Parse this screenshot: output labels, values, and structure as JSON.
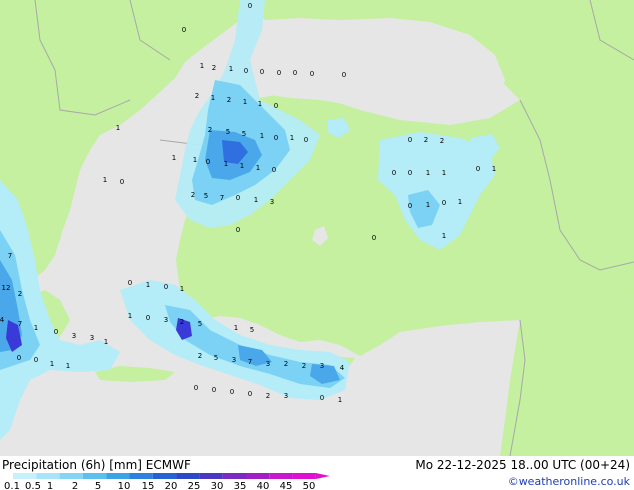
{
  "map": {
    "colors": {
      "sea": "#e6e6e6",
      "land": "#c4f0a0",
      "border": "#a8a8a8",
      "precip_light": "#b4ecf8",
      "precip_mid": "#7cd2f4",
      "precip_heavy": "#4aa8ea",
      "precip_very_heavy": "#2f6fe0",
      "precip_extreme": "#3a3ad8"
    },
    "value_labels": [
      "0",
      "0",
      "1",
      "2",
      "1",
      "0",
      "0",
      "0",
      "0",
      "0",
      "0",
      "2",
      "1",
      "2",
      "1",
      "1",
      "0",
      "2",
      "5",
      "5",
      "1",
      "0",
      "1",
      "0",
      "1",
      "1",
      "0",
      "1",
      "1",
      "1",
      "0",
      "2",
      "5",
      "7",
      "0",
      "1",
      "3",
      "0",
      "0",
      "2",
      "2",
      "0",
      "0",
      "1",
      "1",
      "0",
      "1",
      "0",
      "1",
      "0",
      "1",
      "0",
      "1",
      "1",
      "1",
      "0",
      "7",
      "12",
      "2",
      "4",
      "7",
      "1",
      "0",
      "3",
      "3",
      "1",
      "0",
      "0",
      "1",
      "1",
      "0",
      "1",
      "0",
      "1",
      "1",
      "0",
      "3",
      "2",
      "5",
      "1",
      "5",
      "2",
      "5",
      "3",
      "7",
      "3",
      "2",
      "2",
      "3",
      "4",
      "0",
      "0",
      "0",
      "0",
      "2",
      "3",
      "0",
      "1"
    ]
  },
  "footer": {
    "title": "Precipitation (6h) [mm] ECMWF",
    "datetime": "Mo 22-12-2025 18..00 UTC (00+24)",
    "credit": "©weatheronline.co.uk"
  },
  "scale": {
    "ticks": [
      "0.1",
      "0.5",
      "1",
      "2",
      "5",
      "10",
      "15",
      "20",
      "25",
      "30",
      "35",
      "40",
      "45",
      "50"
    ],
    "colors": [
      "#c8f0fa",
      "#a8e4f8",
      "#84d4f4",
      "#5cc0ee",
      "#3aa4e6",
      "#2c82dc",
      "#2462d2",
      "#2a48c8",
      "#4a38c0",
      "#7a2cc0",
      "#a020c4",
      "#c818cc",
      "#e010d0"
    ]
  }
}
